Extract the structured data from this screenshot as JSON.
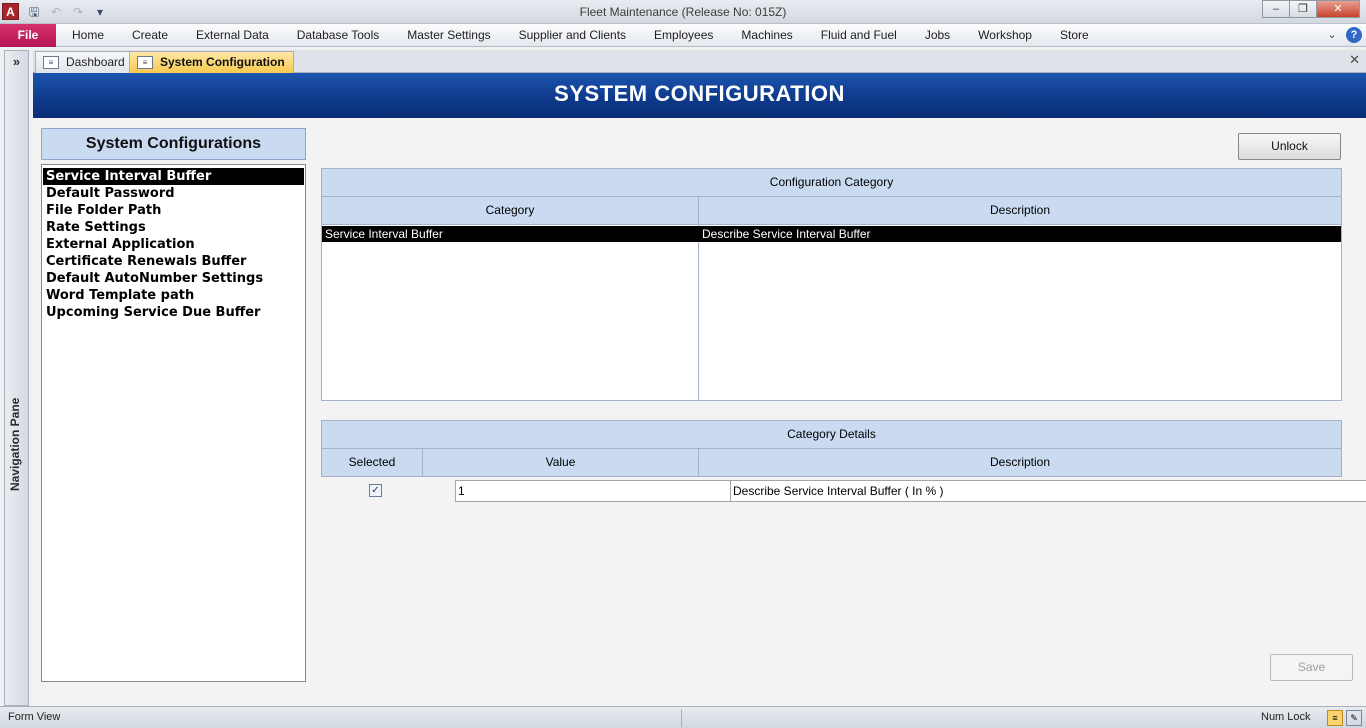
{
  "window": {
    "title": "Fleet Maintenance (Release No: 015Z)",
    "app_icon": "A"
  },
  "ribbon": {
    "file_label": "File",
    "tabs": [
      "Home",
      "Create",
      "External Data",
      "Database Tools",
      "Master Settings",
      "Supplier and Clients",
      "Employees",
      "Machines",
      "Fluid and Fuel",
      "Jobs",
      "Workshop",
      "Store"
    ]
  },
  "nav_pane": {
    "label": "Navigation Pane",
    "expand_glyph": "»"
  },
  "doc_tabs": [
    {
      "label": "Dashboard",
      "active": false
    },
    {
      "label": "System Configuration",
      "active": true
    }
  ],
  "form": {
    "banner_title": "SYSTEM CONFIGURATION",
    "list_title": "System Configurations",
    "list_items": [
      "Service Interval Buffer",
      "Default Password",
      "File Folder Path",
      "Rate Settings",
      "External Application",
      "Certificate Renewals Buffer",
      "Default AutoNumber Settings",
      "Word Template path",
      "Upcoming Service Due Buffer"
    ],
    "selected_list_index": 0,
    "unlock_label": "Unlock",
    "config_category": {
      "caption": "Configuration Category",
      "col_category": "Category",
      "col_description": "Description",
      "row": {
        "category": "Service Interval Buffer",
        "description": "Describe Service Interval Buffer"
      }
    },
    "category_details": {
      "caption": "Category Details",
      "col_selected": "Selected",
      "col_value": "Value",
      "col_description": "Description",
      "row": {
        "selected": true,
        "value": "1",
        "description": "Describe Service Interval Buffer ( In % )"
      }
    },
    "save_label": "Save"
  },
  "status_bar": {
    "view": "Form View",
    "num_lock": "Num Lock"
  }
}
